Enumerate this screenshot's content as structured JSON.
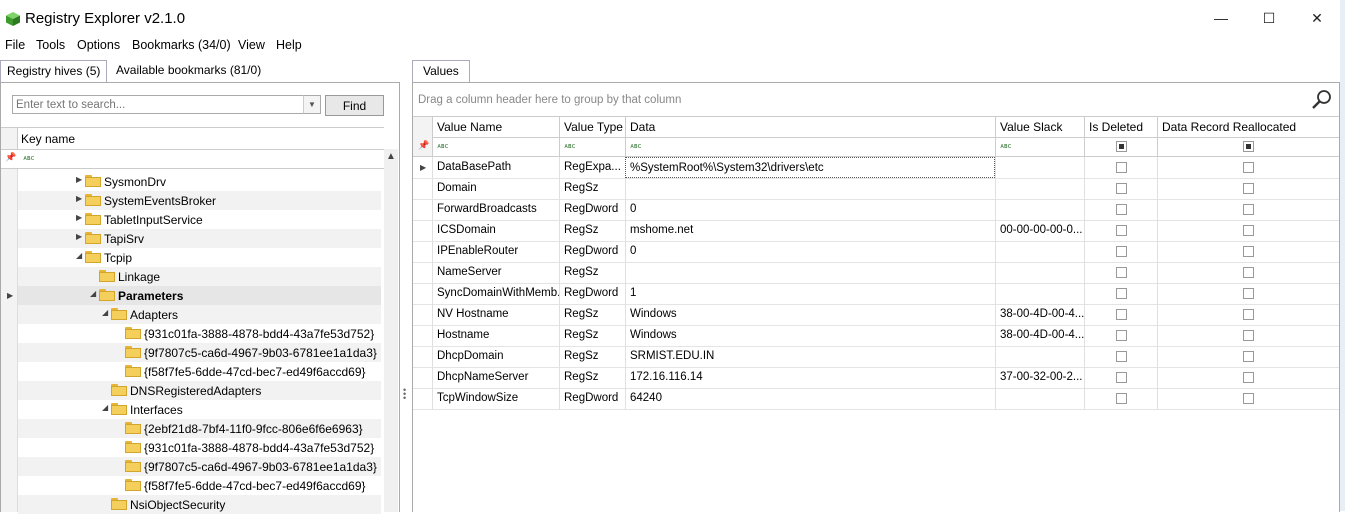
{
  "window": {
    "title": "Registry Explorer v2.1.0",
    "minimize_glyph": "—",
    "maximize_glyph": "☐",
    "close_glyph": "✕"
  },
  "menu": [
    {
      "label": "File"
    },
    {
      "label": "Tools"
    },
    {
      "label": "Options"
    },
    {
      "label": "Bookmarks (34/0)"
    },
    {
      "label": "View"
    },
    {
      "label": "Help"
    }
  ],
  "left": {
    "tabs": [
      {
        "label": "Registry hives (5)",
        "active": true
      },
      {
        "label": "Available bookmarks (81/0)",
        "active": false
      }
    ],
    "search": {
      "placeholder": "Enter text to search...",
      "find_label": "Find"
    },
    "key_header": "Key name",
    "filter_abc": "ᴀʙc",
    "tree": [
      {
        "label": "SysmonDrv",
        "level": 0,
        "expander": "▶",
        "bold": false
      },
      {
        "label": "SystemEventsBroker",
        "level": 0,
        "expander": "▶",
        "bold": false
      },
      {
        "label": "TabletInputService",
        "level": 0,
        "expander": "▶",
        "bold": false
      },
      {
        "label": "TapiSrv",
        "level": 0,
        "expander": "▶",
        "bold": false
      },
      {
        "label": "Tcpip",
        "level": 0,
        "expander": "◢",
        "bold": false
      },
      {
        "label": "Linkage",
        "level": 1,
        "expander": "",
        "bold": false
      },
      {
        "label": "Parameters",
        "level": 1,
        "expander": "◢",
        "bold": true,
        "selected": true
      },
      {
        "label": "Adapters",
        "level": 2,
        "expander": "◢",
        "bold": false
      },
      {
        "label": "{931c01fa-3888-4878-bdd4-43a7fe53d752}",
        "level": 3,
        "expander": "",
        "bold": false
      },
      {
        "label": "{9f7807c5-ca6d-4967-9b03-6781ee1a1da3}",
        "level": 3,
        "expander": "",
        "bold": false
      },
      {
        "label": "{f58f7fe5-6dde-47cd-bec7-ed49f6accd69}",
        "level": 3,
        "expander": "",
        "bold": false
      },
      {
        "label": "DNSRegisteredAdapters",
        "level": 2,
        "expander": "",
        "bold": false
      },
      {
        "label": "Interfaces",
        "level": 2,
        "expander": "◢",
        "bold": false
      },
      {
        "label": "{2ebf21d8-7bf4-11f0-9fcc-806e6f6e6963}",
        "level": 3,
        "expander": "",
        "bold": false
      },
      {
        "label": "{931c01fa-3888-4878-bdd4-43a7fe53d752}",
        "level": 3,
        "expander": "",
        "bold": false
      },
      {
        "label": "{9f7807c5-ca6d-4967-9b03-6781ee1a1da3}",
        "level": 3,
        "expander": "",
        "bold": false
      },
      {
        "label": "{f58f7fe5-6dde-47cd-bec7-ed49f6accd69}",
        "level": 3,
        "expander": "",
        "bold": false
      },
      {
        "label": "NsiObjectSecurity",
        "level": 2,
        "expander": "",
        "bold": false
      }
    ]
  },
  "right": {
    "tab": "Values",
    "group_hint": "Drag a column header here to group by that column",
    "columns": [
      "Value Name",
      "Value Type",
      "Data",
      "Value Slack",
      "Is Deleted",
      "Data Record Reallocated"
    ],
    "rows": [
      {
        "name": "DataBasePath",
        "type": "RegExpa...",
        "data": "%SystemRoot%\\System32\\drivers\\etc",
        "slack": ""
      },
      {
        "name": "Domain",
        "type": "RegSz",
        "data": "",
        "slack": ""
      },
      {
        "name": "ForwardBroadcasts",
        "type": "RegDword",
        "data": "0",
        "slack": ""
      },
      {
        "name": "ICSDomain",
        "type": "RegSz",
        "data": "mshome.net",
        "slack": "00-00-00-00-0..."
      },
      {
        "name": "IPEnableRouter",
        "type": "RegDword",
        "data": "0",
        "slack": ""
      },
      {
        "name": "NameServer",
        "type": "RegSz",
        "data": "",
        "slack": ""
      },
      {
        "name": "SyncDomainWithMemb...",
        "type": "RegDword",
        "data": "1",
        "slack": ""
      },
      {
        "name": "NV Hostname",
        "type": "RegSz",
        "data": "Windows",
        "slack": "38-00-4D-00-4..."
      },
      {
        "name": "Hostname",
        "type": "RegSz",
        "data": "Windows",
        "slack": "38-00-4D-00-4..."
      },
      {
        "name": "DhcpDomain",
        "type": "RegSz",
        "data": "SRMIST.EDU.IN",
        "slack": ""
      },
      {
        "name": "DhcpNameServer",
        "type": "RegSz",
        "data": "172.16.116.14",
        "slack": "37-00-32-00-2..."
      },
      {
        "name": "TcpWindowSize",
        "type": "RegDword",
        "data": "64240",
        "slack": ""
      }
    ]
  },
  "colors": {
    "folder": "#f5cf5c",
    "selected_row": "#e6e6e6",
    "alt_row": "#f2f2f2",
    "abc_green": "#3a7a3a"
  }
}
